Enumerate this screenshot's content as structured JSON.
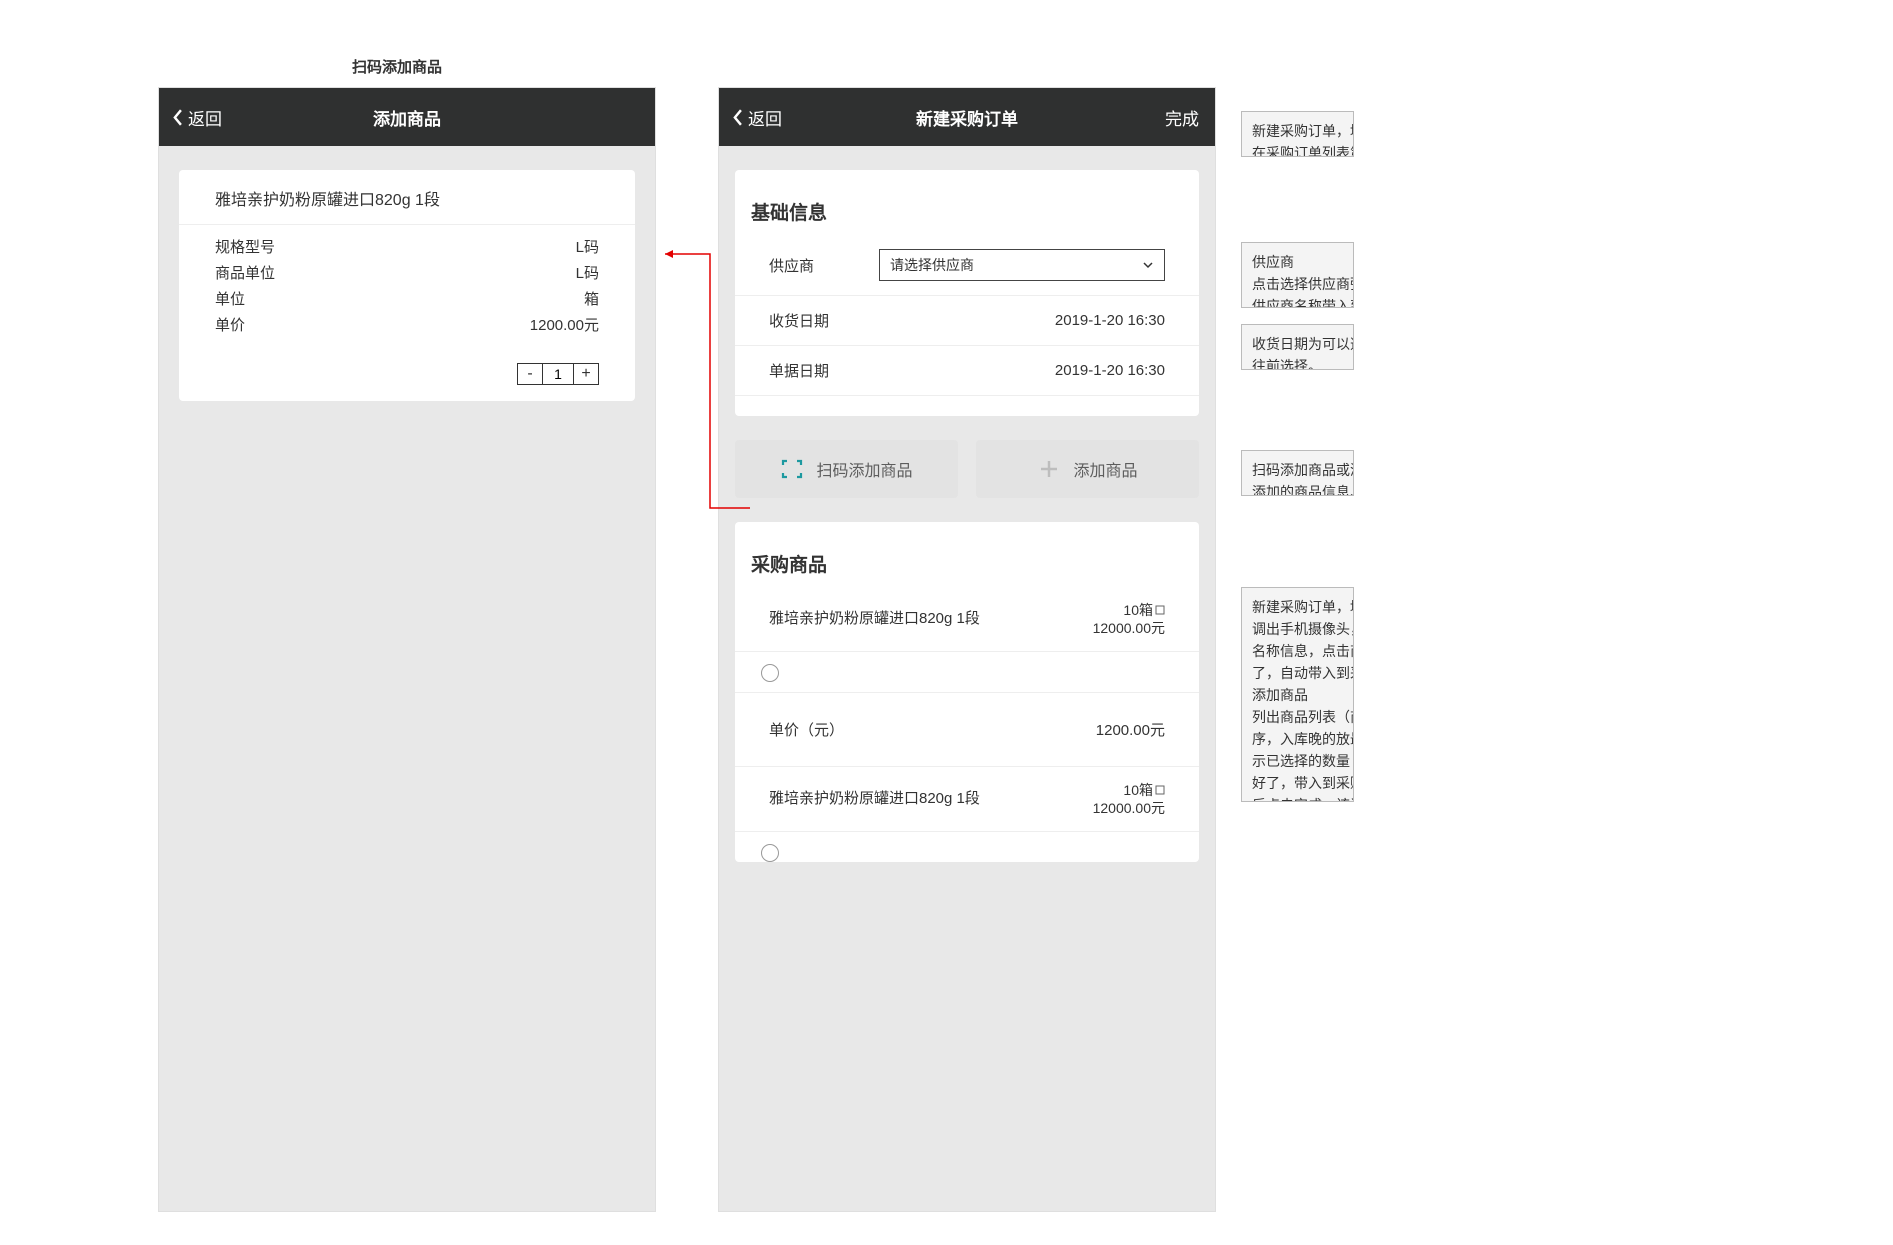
{
  "labels": {
    "scan_add_caption": "扫码添加商品"
  },
  "left": {
    "back": "返回",
    "title": "添加商品",
    "product_name": "雅培亲护奶粉原罐进口820g   1段",
    "specs": [
      {
        "k": "规格型号",
        "v": "L码"
      },
      {
        "k": "商品单位",
        "v": "L码"
      },
      {
        "k": "单位",
        "v": "箱"
      },
      {
        "k": "单价",
        "v": "1200.00元"
      }
    ],
    "stepper": {
      "minus": "-",
      "plus": "+",
      "value": "1"
    }
  },
  "right": {
    "back": "返回",
    "title": "新建采购订单",
    "done": "完成",
    "basic_info_title": "基础信息",
    "form": {
      "supplier_label": "供应商",
      "supplier_placeholder": "请选择供应商",
      "recv_date_label": "收货日期",
      "recv_date_value": "2019-1-20 16:30",
      "doc_date_label": "单据日期",
      "doc_date_value": "2019-1-20 16:30"
    },
    "btn_scan": "扫码添加商品",
    "btn_add": "添加商品",
    "purchase_title": "采购商品",
    "items": [
      {
        "name": "雅培亲护奶粉原罐进口820g   1段",
        "qty": "10箱",
        "amount": "12000.00元"
      },
      {
        "name": "雅培亲护奶粉原罐进口820g   1段",
        "qty": "10箱",
        "amount": "12000.00元"
      }
    ],
    "unit_price": {
      "label": "单价（元）",
      "value": "1200.00元"
    }
  },
  "annotations": {
    "a1": "新建采购订单，填写\n在采购订单列表第一",
    "a2": "供应商\n点击选择供应商弹出\n供应商名称带入到基",
    "a3": "收货日期为可以选择\n往前选择。\n单据日期为制单日期",
    "a4": "扫码添加商品或添加\n添加的商品信息、数",
    "a5": "新建采购订单，填写\n调出手机摄像头，扫\n名称信息，点击商品\n了，自动带入到采购\n添加商品\n列出商品列表（商品\n序，入库晚的放最上\n示已选择的数量（商\n好了，带入到采购商\n后点击完成，该订单\n订单状态为已生成。"
  }
}
